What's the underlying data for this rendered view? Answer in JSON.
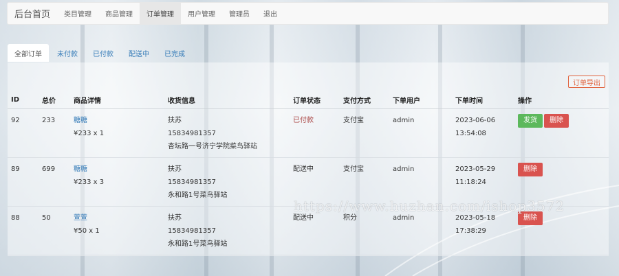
{
  "navbar": {
    "brand": "后台首页",
    "items": [
      {
        "label": "类目管理",
        "active": false
      },
      {
        "label": "商品管理",
        "active": false
      },
      {
        "label": "订单管理",
        "active": true
      },
      {
        "label": "用户管理",
        "active": false
      },
      {
        "label": "管理员",
        "active": false
      },
      {
        "label": "退出",
        "active": false
      }
    ]
  },
  "tabs": [
    {
      "label": "全部订单",
      "active": true
    },
    {
      "label": "未付款",
      "active": false
    },
    {
      "label": "已付款",
      "active": false
    },
    {
      "label": "配送中",
      "active": false
    },
    {
      "label": "已完成",
      "active": false
    }
  ],
  "export_label": "订单导出",
  "table": {
    "headers": [
      "ID",
      "总价",
      "商品详情",
      "收货信息",
      "订单状态",
      "支付方式",
      "下单用户",
      "下单时间",
      "操作"
    ],
    "rows": [
      {
        "id": "92",
        "total": "233",
        "product_name": "糖糖",
        "product_price": "¥233 x 1",
        "receiver": "扶苏",
        "phone": "15834981357",
        "address": "杏坛路一号济宁学院菜鸟驿站",
        "status": "已付款",
        "payment": "支付宝",
        "user": "admin",
        "date": "2023-06-06",
        "time": "13:54:08",
        "actions": [
          "发货",
          "删除"
        ]
      },
      {
        "id": "89",
        "total": "699",
        "product_name": "糖糖",
        "product_price": "¥233 x 3",
        "receiver": "扶苏",
        "phone": "15834981357",
        "address": "永和路1号菜鸟驿站",
        "status": "配送中",
        "payment": "支付宝",
        "user": "admin",
        "date": "2023-05-29",
        "time": "11:18:24",
        "actions": [
          "删除"
        ]
      },
      {
        "id": "88",
        "total": "50",
        "product_name": "萱萱",
        "product_price": "¥50 x 1",
        "receiver": "扶苏",
        "phone": "15834981357",
        "address": "永和路1号菜鸟驿站",
        "status": "配送中",
        "payment": "积分",
        "user": "admin",
        "date": "2023-05-18",
        "time": "17:38:29",
        "actions": [
          "删除"
        ]
      }
    ]
  },
  "watermark": "https://www.huzhan.com/ishop3572",
  "colors": {
    "ship": "#5cb85c",
    "delete": "#d9534f",
    "link": "#337ab7",
    "paid": "#a94442",
    "export": "#e0603a"
  }
}
